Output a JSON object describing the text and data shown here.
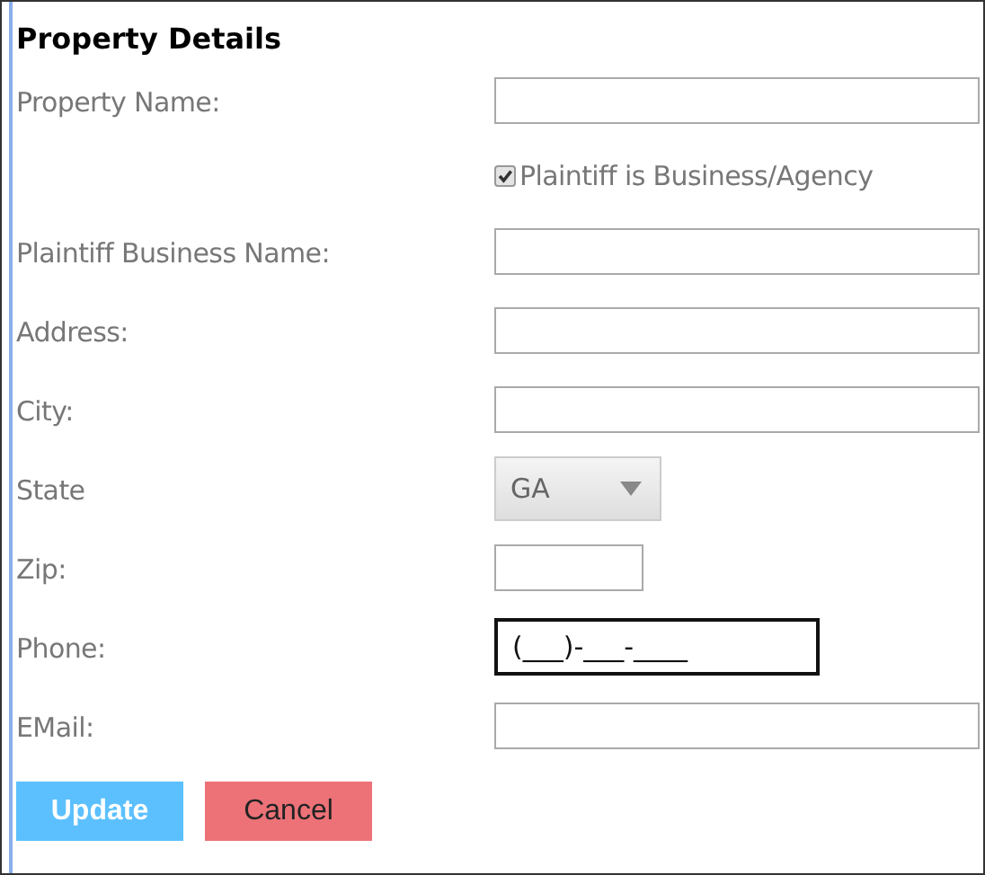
{
  "section": {
    "title": "Property Details"
  },
  "rows": [
    {
      "kind": "text",
      "label": "Property Name:"
    },
    {
      "kind": "checkbox",
      "text": "Plaintiff is Business/Agency",
      "checked": true
    },
    {
      "kind": "text",
      "label": "Plaintiff Business Name:"
    },
    {
      "kind": "text",
      "label": "Address:"
    },
    {
      "kind": "text",
      "label": "City:"
    },
    {
      "kind": "select",
      "label": "State",
      "value": "GA"
    },
    {
      "kind": "zip",
      "label": "Zip:"
    },
    {
      "kind": "phone",
      "label": "Phone:",
      "value": "(___)-___-____",
      "focused": true
    },
    {
      "kind": "text",
      "label": "EMail:"
    }
  ],
  "buttons": [
    {
      "label": "Update",
      "kind": "primary"
    },
    {
      "label": "Cancel",
      "kind": "danger"
    }
  ]
}
